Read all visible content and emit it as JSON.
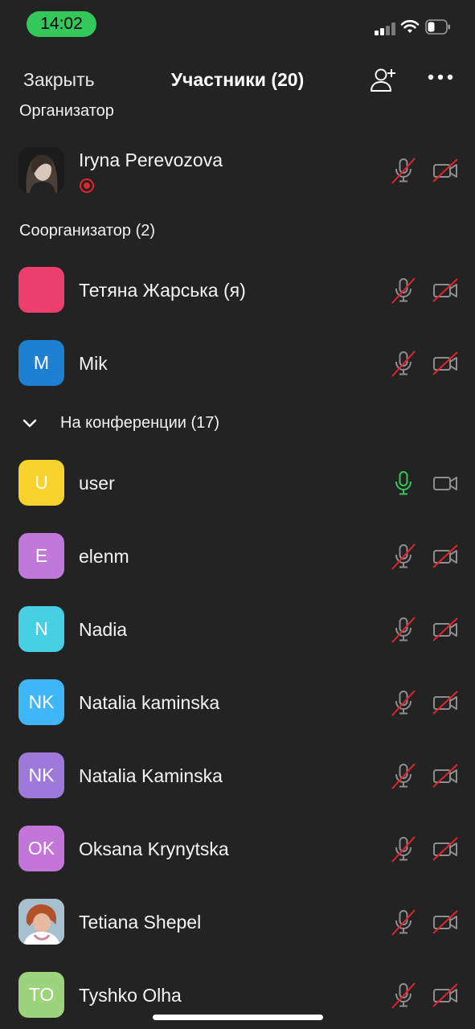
{
  "status_bar": {
    "time": "14:02",
    "time_pill_color": "#34c759",
    "icons": [
      "cellular-signal-icon",
      "wifi-icon",
      "battery-icon"
    ]
  },
  "header": {
    "close_label": "Закрыть",
    "title": "Участники (20)",
    "add_participant_icon": "add-person-icon",
    "more_icon": "more-dots-icon"
  },
  "sections": {
    "host": {
      "label": "Организатор"
    },
    "cohosts": {
      "label": "Соорганизатор (2)"
    },
    "in_meeting": {
      "label": "На конференции (17)",
      "collapse_icon": "chevron-down-icon"
    }
  },
  "participants": {
    "host": {
      "name": "Iryna Perevozova",
      "avatar": "photo",
      "recording": true,
      "mic": "muted",
      "video": "off"
    },
    "cohosts": [
      {
        "name": "Тетяна Жарська (я)",
        "initials": "",
        "color": "#ec3f6e",
        "mic": "muted",
        "video": "off"
      },
      {
        "name": "Mik",
        "initials": "M",
        "color": "#1d80d3",
        "mic": "muted",
        "video": "off"
      }
    ],
    "attendees": [
      {
        "name": "user",
        "initials": "U",
        "color": "#f7d12c",
        "mic": "on",
        "video": "on"
      },
      {
        "name": "elenm",
        "initials": "E",
        "color": "#c079d9",
        "mic": "muted",
        "video": "off"
      },
      {
        "name": "Nadia",
        "initials": "N",
        "color": "#47d0e3",
        "mic": "muted",
        "video": "off"
      },
      {
        "name": "Natalia kaminska",
        "initials": "NK",
        "color": "#3fb6f7",
        "mic": "muted",
        "video": "off"
      },
      {
        "name": "Natalia Kaminska",
        "initials": "NK",
        "color": "#9d7ad9",
        "mic": "muted",
        "video": "off"
      },
      {
        "name": "Oksana Krynytska",
        "initials": "OK",
        "color": "#c376d8",
        "mic": "muted",
        "video": "off"
      },
      {
        "name": "Tetiana Shepel",
        "initials": "",
        "avatar": "photo",
        "mic": "muted",
        "video": "off"
      },
      {
        "name": "Tyshko Olha",
        "initials": "TO",
        "color": "#9dd47b",
        "mic": "muted",
        "video": "off"
      }
    ]
  },
  "colors": {
    "background": "#232323",
    "muted_slash": "#e0242d",
    "mic_active": "#34c759",
    "icon_gray": "#8e8e8e"
  }
}
